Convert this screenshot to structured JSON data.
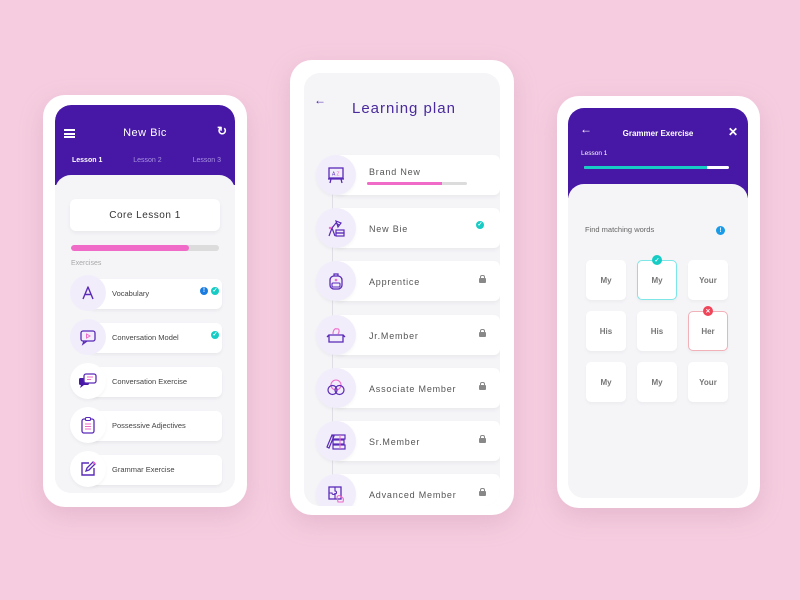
{
  "colors": {
    "background": "#f6cde0",
    "primary": "#4718a6",
    "accent_pink": "#f06bc8",
    "accent_teal": "#17ccc4",
    "info_blue": "#1a7be0",
    "error_red": "#f04458"
  },
  "lesson_screen": {
    "title": "New Bic",
    "menu_icon": "hamburger-menu-icon",
    "refresh_icon": "refresh-icon",
    "tabs": [
      {
        "label": "Lesson 1",
        "active": true
      },
      {
        "label": "Lesson 2",
        "active": false
      },
      {
        "label": "Lesson 3",
        "active": false
      }
    ],
    "core_lesson": "Core Lesson 1",
    "progress_percent": 80,
    "exercises_label": "Exercises",
    "exercises": [
      {
        "label": "Vocabulary",
        "icon": "letter-a-icon",
        "info": true,
        "completed": true
      },
      {
        "label": "Conversation Model",
        "icon": "video-chat-icon",
        "info": false,
        "completed": true
      },
      {
        "label": "Conversation Exercise",
        "icon": "chat-bubbles-icon",
        "info": false,
        "completed": false
      },
      {
        "label": "Possessive Adjectives",
        "icon": "clipboard-icon",
        "info": false,
        "completed": false
      },
      {
        "label": "Grammar Exercise",
        "icon": "edit-icon",
        "info": false,
        "completed": false
      }
    ]
  },
  "plan_screen": {
    "title": "Learning plan",
    "back_icon": "back-arrow-icon",
    "levels": [
      {
        "label": "Brand New",
        "icon": "whiteboard-icon",
        "status": "in-progress",
        "progress_percent": 75
      },
      {
        "label": "New Bie",
        "icon": "desk-lamp-books-icon",
        "status": "completed"
      },
      {
        "label": "Apprentice",
        "icon": "backpack-icon",
        "status": "locked"
      },
      {
        "label": "Jr.Member",
        "icon": "puzzle-box-icon",
        "status": "locked"
      },
      {
        "label": "Associate Member",
        "icon": "conversation-icon",
        "status": "locked"
      },
      {
        "label": "Sr.Member",
        "icon": "books-stack-icon",
        "status": "locked"
      },
      {
        "label": "Advanced Member",
        "icon": "puzzle-pieces-icon",
        "status": "locked"
      }
    ]
  },
  "exercise_screen": {
    "title": "Grammer Exercise",
    "back_icon": "back-arrow-icon",
    "close_icon": "close-icon",
    "lesson_label": "Lesson 1",
    "progress_percent": 85,
    "instruction": "Find matching words",
    "info_mark": "!",
    "grid": [
      {
        "word": "My",
        "state": "normal"
      },
      {
        "word": "My",
        "state": "correct"
      },
      {
        "word": "Your",
        "state": "normal"
      },
      {
        "word": "His",
        "state": "normal"
      },
      {
        "word": "His",
        "state": "normal"
      },
      {
        "word": "Her",
        "state": "wrong"
      },
      {
        "word": "My",
        "state": "normal"
      },
      {
        "word": "My",
        "state": "normal"
      },
      {
        "word": "Your",
        "state": "normal"
      }
    ]
  }
}
